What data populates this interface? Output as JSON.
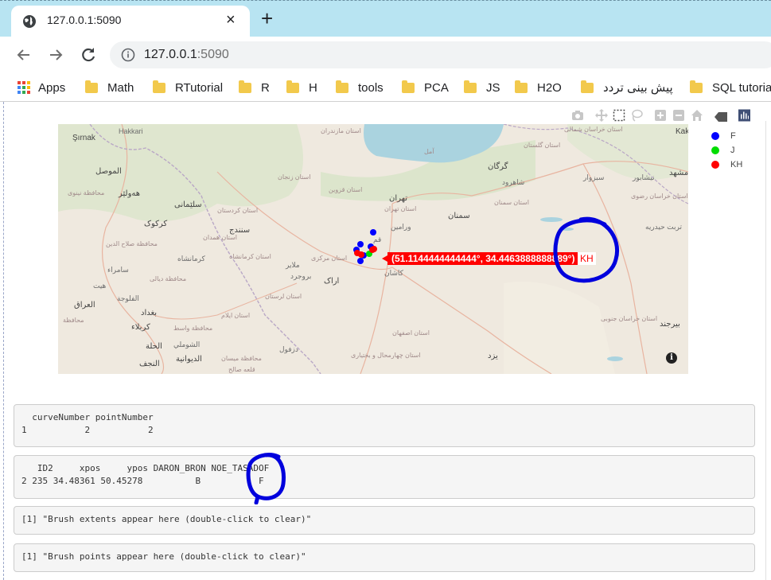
{
  "browser": {
    "tab_title": "127.0.0.1:5090",
    "url_host": "127.0.0.1",
    "url_port": ":5090",
    "new_tab_icon": "+",
    "close_icon": "×",
    "bookmarks": [
      {
        "label": "Apps",
        "icon": "apps-grid"
      },
      {
        "label": "Math",
        "icon": "folder"
      },
      {
        "label": "RTutorial",
        "icon": "folder"
      },
      {
        "label": "R",
        "icon": "folder"
      },
      {
        "label": "H",
        "icon": "folder"
      },
      {
        "label": "tools",
        "icon": "folder"
      },
      {
        "label": "PCA",
        "icon": "folder"
      },
      {
        "label": "JS",
        "icon": "folder"
      },
      {
        "label": "H2O",
        "icon": "folder"
      },
      {
        "label": "پیش بینی تردد",
        "icon": "folder"
      },
      {
        "label": "SQL tutoria",
        "icon": "folder"
      }
    ]
  },
  "map": {
    "labels": {
      "sirnak": "Şırnak",
      "hakkari": "Hakkari",
      "mosul": "الموصل",
      "dohuk": "محافظة نينوى",
      "erbil": "هەولێر",
      "sulaymaniyah": "سلێمانی",
      "kirkuk": "کرکوک",
      "saladin": "محافظة صلاح الدين",
      "samarra": "سامراء",
      "diyala": "محافظة ديالى",
      "hit": "هيت",
      "fallujah": "الفلوجة",
      "iraq": "العراق",
      "baghdad": "بغداد",
      "karbala": "كربلاء",
      "wasit": "محافظة واسط",
      "hillah": "الحلة",
      "najaf": "النجف",
      "diwaniyah": "الديوانية",
      "shumali": "الشوملي",
      "muhafaza": "محافظة",
      "kordestan": "استان کردستان",
      "sanandaj": "سنندج",
      "kermanshah": "استان کرمانشاه",
      "kermanshah_city": "کرمانشاه",
      "ilam": "استان ايلام",
      "lorestan": "استان لرستان",
      "hamedan": "استان همدان",
      "malayer": "ملایر",
      "boroujerd": "بروجرد",
      "arak": "اراک",
      "markazi": "استان مرکزی",
      "zanjan": "استان زنجان",
      "qazvin": "استان قزوین",
      "tehran": "تهران",
      "tehran_prov": "استان تهران",
      "varamin": "ورامین",
      "qom": "قم",
      "kashan": "کاشان",
      "semnan": "سمنان",
      "semnan_prov": "استان سمنان",
      "gorgan": "گرگان",
      "golestan": "استان گلستان",
      "mazandaran": "استان مازندران",
      "shahrud": "شاهرود",
      "khorasan_north": "استان خراسان شمالی",
      "mashhad": "مشهد",
      "sabzevar": "سبزوار",
      "neyshabur": "نیشابور",
      "khorasan_razavi": "استان خراسان رضوی",
      "torbat": "تربت حیدریه",
      "khorasan_south": "استان خراسان جنوبی",
      "birjand": "بیرجند",
      "isfahan": "استان اصفهان",
      "yazd": "یزد",
      "dezful": "دزفول",
      "chaharmahal": "استان چهارمحال و بختیاری",
      "basra": "قلعه صالح",
      "maysan": "محافظة ميسان",
      "kaka": "Kaka",
      "amirkola": "آمل"
    },
    "tooltip_text": "(51.1144444444444°, 34.4463888888889°)",
    "tooltip_name": "KH",
    "info_icon_label": "i"
  },
  "legend": [
    {
      "name": "F",
      "color": "#0000ff"
    },
    {
      "name": "J",
      "color": "#00dd00"
    },
    {
      "name": "KH",
      "color": "#ff0000"
    }
  ],
  "outputs": {
    "click": "  curveNumber pointNumber\n1           2           2",
    "row": "   ID2     xpos     ypos DARON_BRON NOE_TASADOF\n2 235 34.48361 50.45278          B           F",
    "brush_extents": "[1] \"Brush extents appear here (double-click to clear)\"",
    "brush_points": "[1] \"Brush points appear here (double-click to clear)\""
  },
  "colors": {
    "tab_strip": "#b8e4f2",
    "annotation_blue": "#0000dd"
  }
}
